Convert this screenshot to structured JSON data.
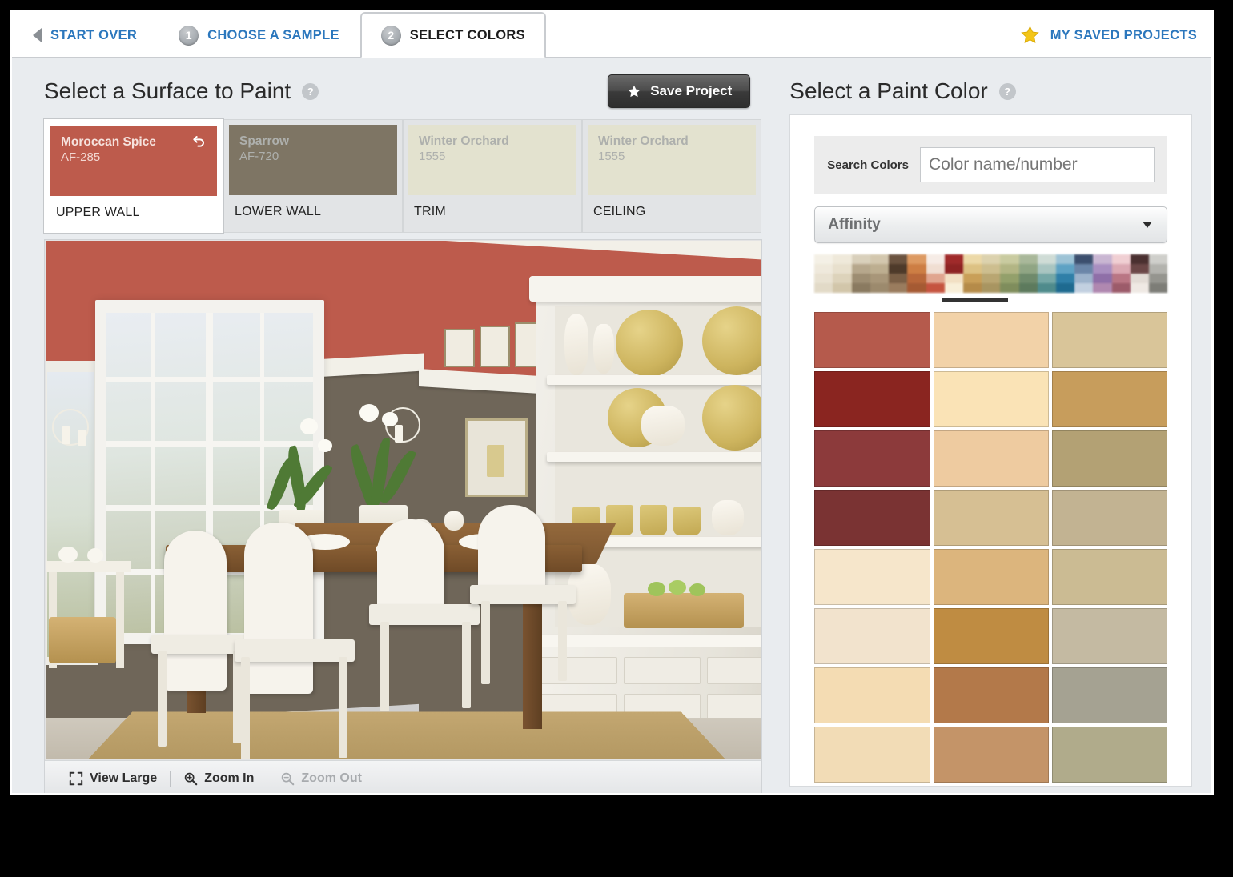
{
  "nav": {
    "start_over": "START OVER",
    "back_icon": "back-arrow-icon",
    "steps": [
      {
        "number": "1",
        "label": "CHOOSE A SAMPLE",
        "active": false
      },
      {
        "number": "2",
        "label": "SELECT COLORS",
        "active": true
      }
    ],
    "saved_projects": "MY SAVED PROJECTS",
    "star_icon": "star-icon"
  },
  "left": {
    "title": "Select a Surface to Paint",
    "help_icon": "help-icon",
    "help_glyph": "?",
    "save_button": {
      "label": "Save Project",
      "icon": "star-icon"
    },
    "surfaces": [
      {
        "name": "Moroccan Spice",
        "code": "AF-285",
        "label": "UPPER WALL",
        "color": "#bd5b4c",
        "selected": true,
        "revert_icon": "undo-arrow-icon"
      },
      {
        "name": "Sparrow",
        "code": "AF-720",
        "label": "LOWER WALL",
        "color": "#7e7564",
        "selected": false
      },
      {
        "name": "Winter Orchard",
        "code": "1555",
        "label": "TRIM",
        "color": "#e3e2cf",
        "selected": false
      },
      {
        "name": "Winter Orchard",
        "code": "1555",
        "label": "CEILING",
        "color": "#e3e2cf",
        "selected": false
      }
    ],
    "toolbar": {
      "view_large": {
        "label": "View Large",
        "icon": "expand-icon",
        "disabled": false
      },
      "zoom_in": {
        "label": "Zoom In",
        "icon": "zoom-in-icon",
        "disabled": false
      },
      "zoom_out": {
        "label": "Zoom Out",
        "icon": "zoom-out-icon",
        "disabled": true
      }
    },
    "photo": {
      "alt": "dining-room-preview",
      "upper_wall_color": "#bd5b4c",
      "lower_wall_color": "#6f6659",
      "trim_color": "#f2f0e8"
    }
  },
  "right": {
    "title": "Select a Paint Color",
    "help_icon": "help-icon",
    "help_glyph": "?",
    "search": {
      "label": "Search Colors",
      "placeholder": "Color name/number",
      "value": ""
    },
    "family_select": {
      "value": "Affinity",
      "caret_icon": "chevron-down-icon"
    },
    "family_strip": {
      "columns": [
        [
          "#f4f0e6",
          "#efe9dc",
          "#e9e2d2",
          "#e2dac7"
        ],
        [
          "#efe9da",
          "#e8e0cd",
          "#ddd3bb",
          "#d2c6aa"
        ],
        [
          "#d9d0bb",
          "#b6a78c",
          "#9d8d72",
          "#8a7a60"
        ],
        [
          "#d3c7ae",
          "#bdae90",
          "#a89679",
          "#9c8a6d"
        ],
        [
          "#6b5340",
          "#4e3a2a",
          "#7a5f46",
          "#9a7c5e"
        ],
        [
          "#dd9a62",
          "#cd7e44",
          "#b8673a",
          "#a55a33"
        ],
        [
          "#f6ece6",
          "#f0ded2",
          "#e0a58f",
          "#c5543f"
        ],
        [
          "#a02a2a",
          "#8e2323",
          "#f2e0c4",
          "#f8efd9"
        ],
        [
          "#ecd9a8",
          "#dcc183",
          "#c99f58",
          "#b58b49"
        ],
        [
          "#dcd2ae",
          "#cdbe8f",
          "#b9a672",
          "#a89561"
        ],
        [
          "#c9cba0",
          "#b2b584",
          "#93a06b",
          "#7f8d5c"
        ],
        [
          "#a9b89a",
          "#90a584",
          "#6f8a6b",
          "#5d7a5d"
        ],
        [
          "#cfdcd6",
          "#a9c5c1",
          "#75a7a6",
          "#4f8b8c"
        ],
        [
          "#9dc3d6",
          "#5ea2c4",
          "#2f7fa8",
          "#1e6a90"
        ],
        [
          "#3c4f6e",
          "#6b86a8",
          "#9db3cb",
          "#c2d0e0"
        ],
        [
          "#c9b6d2",
          "#a98fc0",
          "#8f6fa8",
          "#b088b0"
        ],
        [
          "#f0cfd3",
          "#dba9b3",
          "#b97684",
          "#9c5b6a"
        ],
        [
          "#4a3030",
          "#6b4747",
          "#e3dcd6",
          "#efe9e4"
        ],
        [
          "#cfcfcb",
          "#b3b3ae",
          "#95958f",
          "#7d7d77"
        ]
      ],
      "indicator": "selected-family-indicator"
    },
    "swatch_grid": {
      "columns": 3,
      "rows": 8,
      "colors": [
        [
          "#b55a4c",
          "#f2d2a8",
          "#d9c599"
        ],
        [
          "#8a2520",
          "#fae3b6",
          "#c79d5c"
        ],
        [
          "#8c3a3b",
          "#eecba0",
          "#b3a174"
        ],
        [
          "#7a3333",
          "#d6bf93",
          "#c2b392"
        ],
        [
          "#f6e6cb",
          "#dcb57d",
          "#cbbb93"
        ],
        [
          "#f2e3cd",
          "#bf8c42",
          "#c4baa2"
        ],
        [
          "#f4dcb3",
          "#b3794a",
          "#a5a292"
        ],
        [
          "#f2dcb6",
          "#c49468",
          "#b0ab8b"
        ]
      ]
    }
  }
}
